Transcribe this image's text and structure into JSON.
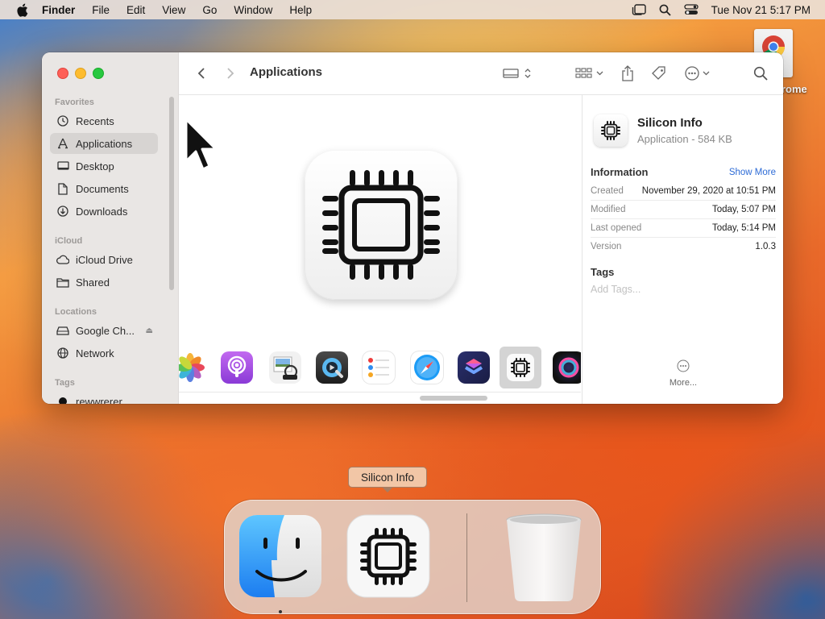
{
  "menubar": {
    "app_name": "Finder",
    "items": [
      "File",
      "Edit",
      "View",
      "Go",
      "Window",
      "Help"
    ],
    "datetime": "Tue Nov 21  5:17 PM"
  },
  "desktop": {
    "icon_label": "rome"
  },
  "window": {
    "title": "Applications",
    "sidebar": {
      "favorites_header": "Favorites",
      "favorites": [
        {
          "label": "Recents",
          "icon": "clock-icon"
        },
        {
          "label": "Applications",
          "icon": "applications-icon",
          "selected": true
        },
        {
          "label": "Desktop",
          "icon": "desktop-icon"
        },
        {
          "label": "Documents",
          "icon": "document-icon"
        },
        {
          "label": "Downloads",
          "icon": "download-icon"
        }
      ],
      "icloud_header": "iCloud",
      "icloud": [
        {
          "label": "iCloud Drive",
          "icon": "cloud-icon"
        },
        {
          "label": "Shared",
          "icon": "shared-folder-icon"
        }
      ],
      "locations_header": "Locations",
      "locations": [
        {
          "label": "Google Ch...",
          "icon": "drive-icon"
        },
        {
          "label": "Network",
          "icon": "globe-icon"
        }
      ],
      "tags_header": "Tags",
      "tags": [
        {
          "label": "rewwrerer",
          "icon": "tag-dot-icon"
        }
      ]
    },
    "info": {
      "name": "Silicon Info",
      "kind_size": "Application - 584 KB",
      "information_header": "Information",
      "show_more": "Show More",
      "rows": [
        {
          "key": "Created",
          "value": "November 29, 2020 at 10:51 PM"
        },
        {
          "key": "Modified",
          "value": "Today, 5:07 PM"
        },
        {
          "key": "Last opened",
          "value": "Today, 5:14 PM"
        },
        {
          "key": "Version",
          "value": "1.0.3"
        }
      ],
      "tags_header": "Tags",
      "add_tags_placeholder": "Add Tags...",
      "more_label": "More..."
    },
    "strip_apps": [
      "photos-icon",
      "podcasts-icon",
      "preview-icon",
      "quicktime-icon",
      "reminders-icon",
      "safari-icon",
      "shortcuts-icon",
      "silicon-info-icon",
      "siri-icon"
    ]
  },
  "dock": {
    "tooltip": "Silicon Info",
    "items": [
      "finder-icon",
      "silicon-info-icon",
      "trash-icon"
    ]
  }
}
